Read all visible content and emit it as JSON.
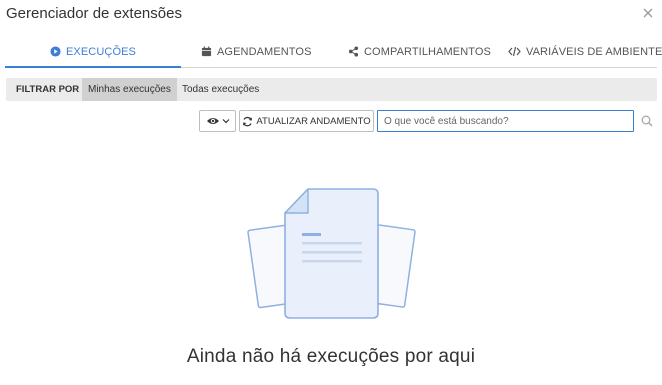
{
  "window": {
    "title": "Gerenciador de extensões",
    "close_icon": "close-icon"
  },
  "tabs": [
    {
      "label": "EXECUÇÕES",
      "icon": "play-circle-icon",
      "active": true
    },
    {
      "label": "AGENDAMENTOS",
      "icon": "calendar-icon",
      "active": false
    },
    {
      "label": "COMPARTILHAMENTOS",
      "icon": "share-icon",
      "active": false
    },
    {
      "label": "VARIÁVEIS DE AMBIENTE",
      "icon": "code-icon",
      "active": false
    }
  ],
  "filter": {
    "label": "FILTRAR POR",
    "options": [
      {
        "label": "Minhas execuções",
        "selected": true
      },
      {
        "label": "Todas execuções",
        "selected": false
      }
    ]
  },
  "toolbar": {
    "view_toggle_icon": "eye-icon",
    "refresh_label": "ATUALIZAR ANDAMENTO",
    "refresh_icon": "refresh-icon",
    "search_placeholder": "O que você está buscando?",
    "search_value": "",
    "search_icon": "search-icon"
  },
  "empty_state": {
    "message": "Ainda não há execuções por aqui",
    "illustration": "document-stack-icon"
  },
  "colors": {
    "accent": "#3a7fd6",
    "filter_bg": "#ebebeb",
    "filter_selected_bg": "#d0d0d0",
    "illustration_stroke": "#8fb0e3",
    "illustration_fill": "#e9f0fb"
  }
}
